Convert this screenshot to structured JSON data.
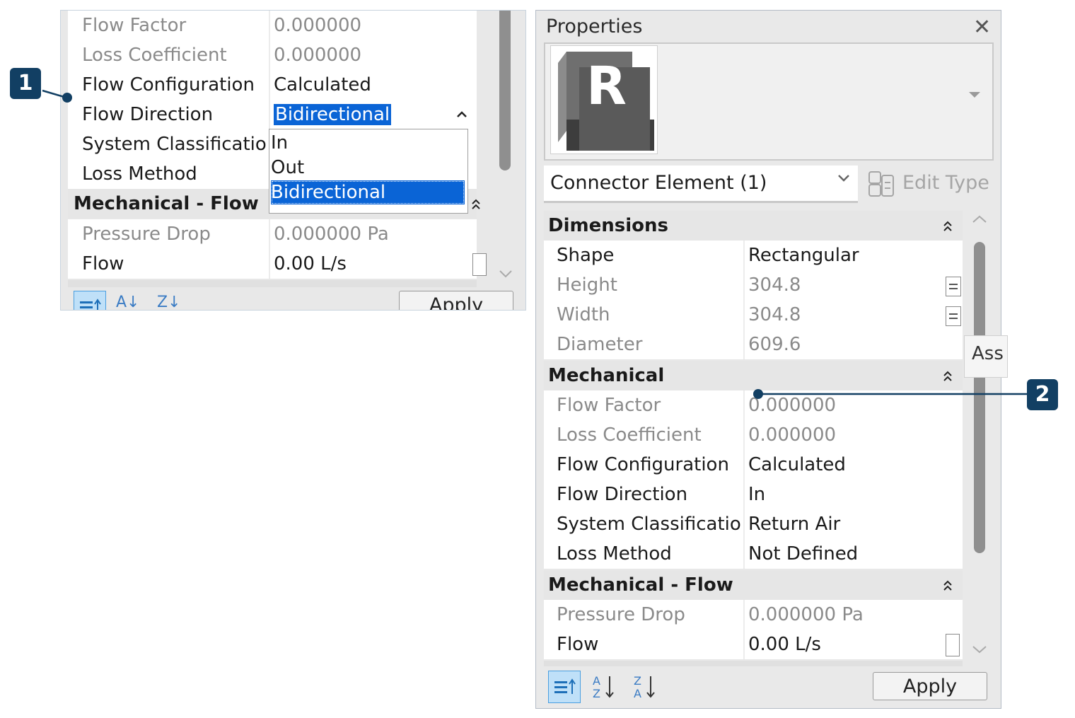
{
  "left_panel": {
    "rows_top": [
      {
        "name": "Flow Factor",
        "value": "0.000000",
        "disabled": true
      },
      {
        "name": "Loss Coefficient",
        "value": "0.000000",
        "disabled": true
      },
      {
        "name": "Flow Configuration",
        "value": "Calculated",
        "disabled": false
      },
      {
        "name": "Flow Direction",
        "value": "Bidirectional",
        "disabled": false
      },
      {
        "name": "System Classification",
        "value": "",
        "disabled": false
      },
      {
        "name": "Loss Method",
        "value": "",
        "disabled": false
      }
    ],
    "group": "Mechanical - Flow",
    "rows_bottom": [
      {
        "name": "Pressure Drop",
        "value": "0.000000 Pa",
        "disabled": true
      },
      {
        "name": "Flow",
        "value": "0.00 L/s",
        "disabled": false
      }
    ],
    "dropdown": {
      "options": [
        "In",
        "Out",
        "Bidirectional"
      ],
      "selected": "Bidirectional"
    },
    "apply_label": "Apply"
  },
  "properties": {
    "title": "Properties",
    "close_glyph": "✕",
    "type_logo_letter": "R",
    "instance_filter": "Connector Element (1)",
    "edit_type_label": "Edit Type",
    "groups": [
      {
        "name": "Dimensions",
        "rows": [
          {
            "name": "Shape",
            "value": "Rectangular",
            "disabled": false
          },
          {
            "name": "Height",
            "value": "304.8",
            "disabled": true
          },
          {
            "name": "Width",
            "value": "304.8",
            "disabled": true
          },
          {
            "name": "Diameter",
            "value": "609.6",
            "disabled": true
          }
        ]
      },
      {
        "name": "Mechanical",
        "rows": [
          {
            "name": "Flow Factor",
            "value": "0.000000",
            "disabled": true
          },
          {
            "name": "Loss Coefficient",
            "value": "0.000000",
            "disabled": true
          },
          {
            "name": "Flow Configuration",
            "value": "Calculated",
            "disabled": false
          },
          {
            "name": "Flow Direction",
            "value": "In",
            "disabled": false
          },
          {
            "name": "System Classification",
            "value": "Return Air",
            "disabled": false
          },
          {
            "name": "Loss Method",
            "value": "Not Defined",
            "disabled": false
          }
        ]
      },
      {
        "name": "Mechanical - Flow",
        "rows": [
          {
            "name": "Pressure Drop",
            "value": "0.000000 Pa",
            "disabled": true
          },
          {
            "name": "Flow",
            "value": "0.00 L/s",
            "disabled": false
          }
        ]
      }
    ],
    "tooltip": "Ass",
    "apply_label": "Apply"
  },
  "callouts": [
    "1",
    "2"
  ],
  "colors": {
    "selection": "#0a64d6",
    "callout": "#123f63",
    "disabled_text": "#8a8a8a",
    "sort_active_bg": "#bfe0f8"
  },
  "icons": {
    "collapse": "collapse-up-icon",
    "sort_categorized": "categorized-sort-icon",
    "sort_az": "sort-az-icon",
    "sort_za": "sort-za-icon",
    "edit_type": "edit-type-icon"
  }
}
